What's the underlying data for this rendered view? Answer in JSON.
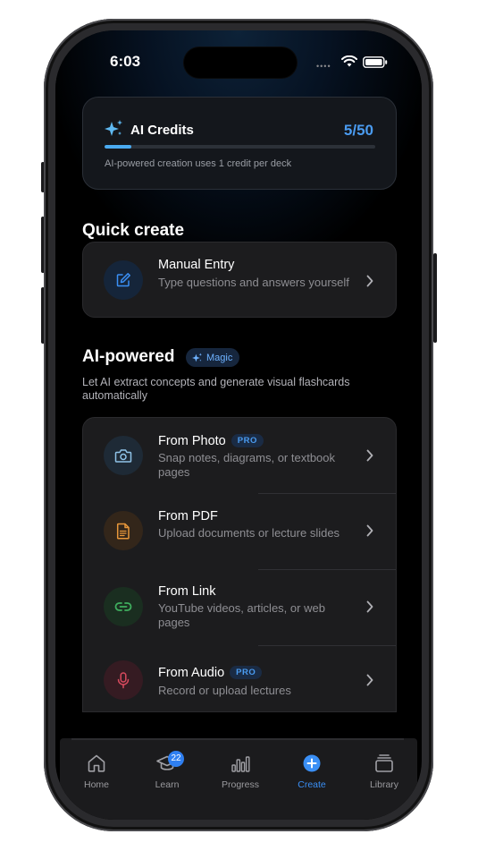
{
  "status": {
    "time": "6:03"
  },
  "credits": {
    "title": "AI Credits",
    "count": "5/50",
    "used": 5,
    "total": 50,
    "note": "AI-powered creation uses 1 credit per deck"
  },
  "quick_create": {
    "title": "Quick create",
    "items": [
      {
        "title": "Manual Entry",
        "subtitle": "Type questions and answers yourself",
        "icon": "edit-icon"
      }
    ]
  },
  "ai_powered": {
    "title": "AI-powered",
    "badge": "Magic",
    "description": "Let AI extract concepts and generate visual flashcards automatically",
    "items": [
      {
        "title": "From Photo",
        "subtitle": "Snap notes, diagrams, or textbook pages",
        "pro": "PRO",
        "icon": "camera-icon"
      },
      {
        "title": "From PDF",
        "subtitle": "Upload documents or lecture slides",
        "icon": "document-icon"
      },
      {
        "title": "From Link",
        "subtitle": "YouTube videos, articles, or web pages",
        "icon": "link-icon"
      },
      {
        "title": "From Audio",
        "subtitle": "Record or upload lectures",
        "pro": "PRO",
        "icon": "microphone-icon"
      }
    ]
  },
  "tabs": [
    {
      "label": "Home",
      "icon": "home-icon"
    },
    {
      "label": "Learn",
      "icon": "graduation-cap-icon",
      "badge": "22"
    },
    {
      "label": "Progress",
      "icon": "bar-chart-icon"
    },
    {
      "label": "Create",
      "icon": "plus-circle-icon",
      "active": true
    },
    {
      "label": "Library",
      "icon": "stack-icon"
    }
  ],
  "colors": {
    "accent": "#3a8ff5",
    "camera": "#8fc3e8",
    "pdf": "#e8973a",
    "link": "#3fae5e",
    "audio": "#d84a5e"
  }
}
